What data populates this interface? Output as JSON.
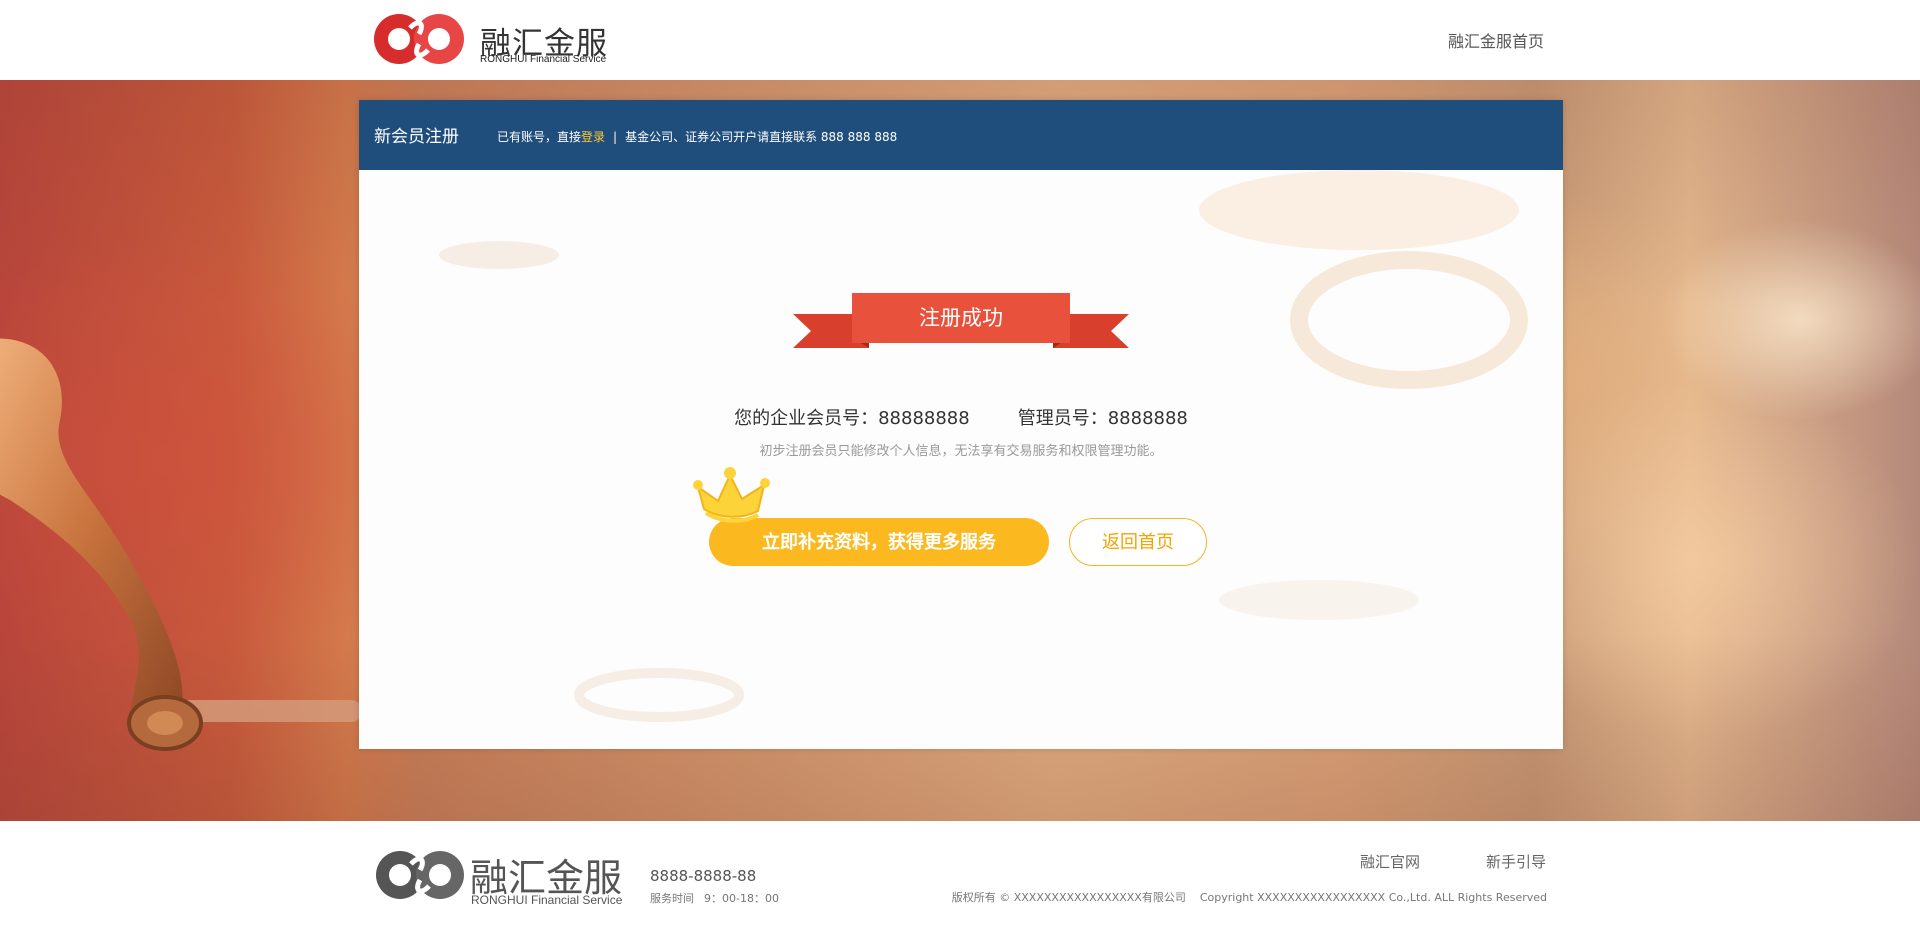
{
  "header": {
    "logo_cn": "融汇金服",
    "logo_en": "RONGHUI Financial Service",
    "home_link": "融汇金服首页"
  },
  "card": {
    "title": "新会员注册",
    "has_account_prefix": "已有账号，直接",
    "login_link": "登录",
    "separator": "|",
    "contact_note": "基金公司、证券公司开户请直接联系 888 888 888"
  },
  "result": {
    "ribbon_text": "注册成功",
    "enterprise_member_no": "您的企业会员号：88888888",
    "admin_no": "管理员号：8888888",
    "note": "初步注册会员只能修改个人信息，无法享有交易服务和权限管理功能。",
    "primary_button": "立即补充资料，获得更多服务",
    "secondary_button": "返回首页"
  },
  "footer": {
    "logo_cn": "融汇金服",
    "logo_en": "RONGHUI Financial Service",
    "phone": "8888-8888-88",
    "hours_label": "服务时间",
    "hours_value": "9：00-18：00",
    "links": [
      "融汇官网",
      "新手引导"
    ],
    "copyright_cn": "版权所有 © XXXXXXXXXXXXXXXXX有限公司",
    "copyright_en": "Copyright XXXXXXXXXXXXXXXXX Co.,Ltd. ALL Rights Reserved"
  },
  "colors": {
    "brand_red": "#e23a3a",
    "bar_blue": "#1f4d7c",
    "ribbon_red": "#e8523d",
    "button_yellow": "#fbb91f",
    "login_yellow": "#ffcc33"
  }
}
